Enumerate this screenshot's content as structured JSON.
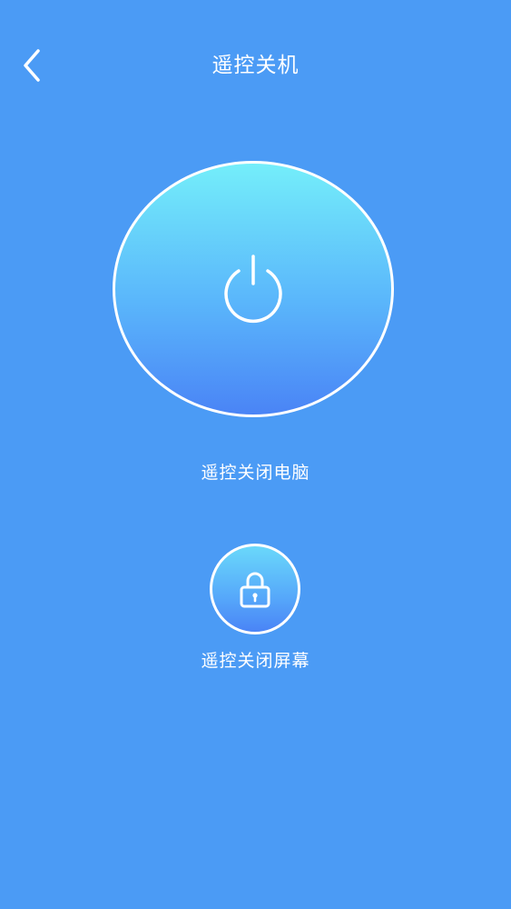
{
  "header": {
    "title": "遥控关机",
    "back_icon": "chevron-left-icon"
  },
  "shutdown_pc": {
    "icon": "power-icon",
    "label": "遥控关闭电脑"
  },
  "lock_screen": {
    "icon": "lock-icon",
    "label": "遥控关闭屏幕"
  },
  "colors": {
    "background": "#4b9bf5",
    "gradient_top": "#74eefa",
    "gradient_bottom": "#4a84f6",
    "foreground": "#ffffff"
  }
}
